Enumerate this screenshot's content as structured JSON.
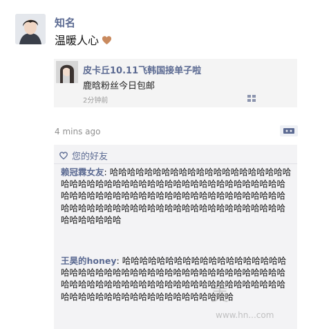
{
  "post": {
    "author": "知名",
    "text": "温暖人心",
    "emoji_icon": "heart-brown-icon",
    "time": "4 mins ago"
  },
  "shared_link": {
    "title": "皮卡丘10.11飞韩国接单子啦",
    "subtitle": "鹿晗粉丝今日包邮",
    "time": "2分钟前"
  },
  "likes": {
    "label": "您的好友"
  },
  "comments": [
    {
      "name": "赖冠霖女友",
      "text": "哈哈哈哈哈哈哈哈哈哈哈哈哈哈哈哈哈哈哈哈哈哈哈哈哈哈哈哈哈哈哈哈哈哈哈哈哈哈哈哈哈哈哈哈哈哈哈哈哈哈哈哈哈哈哈哈哈哈哈哈哈哈哈哈哈哈哈哈哈哈哈哈哈哈哈哈哈哈哈哈哈哈哈哈哈哈哈哈哈哈哈哈哈哈哈哈哈哈哈哈哈哈哈哈哈哈"
    },
    {
      "name": "王昊的honey",
      "text": "哈哈哈哈哈哈哈哈哈哈哈哈哈哈哈哈哈哈哈哈哈哈哈哈哈哈哈哈哈哈哈哈哈哈哈哈哈哈哈哈哈哈哈哈哈哈哈哈哈哈哈哈哈哈哈哈哈哈哈哈哈哈哈哈哈哈哈哈哈哈哈哈哈哈哈哈哈哈哈哈哈哈哈哈哈哈哈哈哈哈哈"
    }
  ],
  "watermark": {
    "text": "美",
    "url": "www.hn...com"
  },
  "colors": {
    "name": "#5b6a92",
    "panel": "#f3f3f5"
  }
}
